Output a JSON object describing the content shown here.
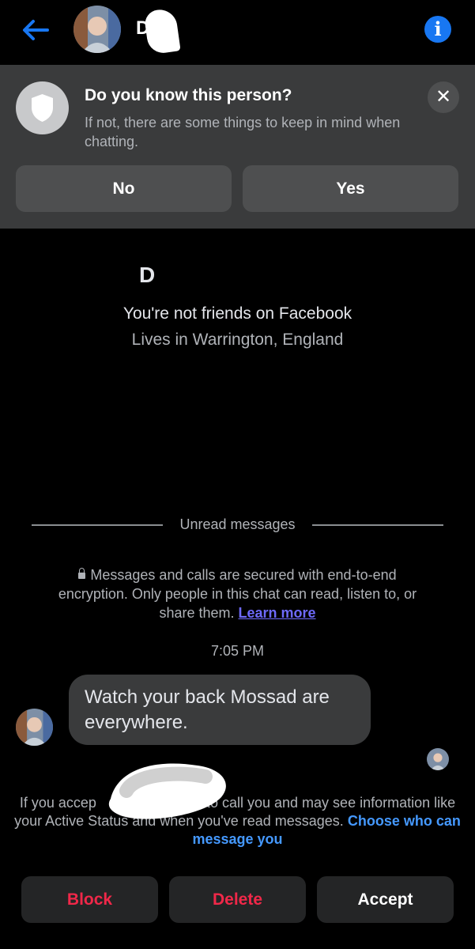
{
  "header": {
    "contact_name": "Da",
    "back_icon": "arrow-left-icon",
    "info_icon": "info-icon"
  },
  "banner": {
    "title": "Do you know this person?",
    "body": "If not, there are some things to keep in mind when chatting.",
    "no_label": "No",
    "yes_label": "Yes",
    "shield_icon": "shield-icon",
    "close_icon": "close-icon"
  },
  "profile": {
    "name": "D",
    "friend_status": "You're not friends on Facebook",
    "location": "Lives in Warrington, England"
  },
  "divider": {
    "label": "Unread messages"
  },
  "encryption": {
    "text": "Messages and calls are secured with end-to-end encryption. Only people in this chat can read, listen to, or share them.",
    "link": "Learn more"
  },
  "conversation": {
    "timestamp": "7:05 PM",
    "messages": [
      {
        "text": "Watch your back Mossad are everywhere."
      }
    ]
  },
  "request_notice": {
    "part1": "If you accep",
    "part2": "be able to call you and may see information like your Active Status and when you've read messages.",
    "link": "Choose who can message you"
  },
  "actions": {
    "block": "Block",
    "delete": "Delete",
    "accept": "Accept"
  },
  "colors": {
    "accent": "#1877f2",
    "danger": "#f02849",
    "link": "#4599ff",
    "learn_more": "#6e6afa",
    "banner_bg": "#3a3b3c"
  }
}
